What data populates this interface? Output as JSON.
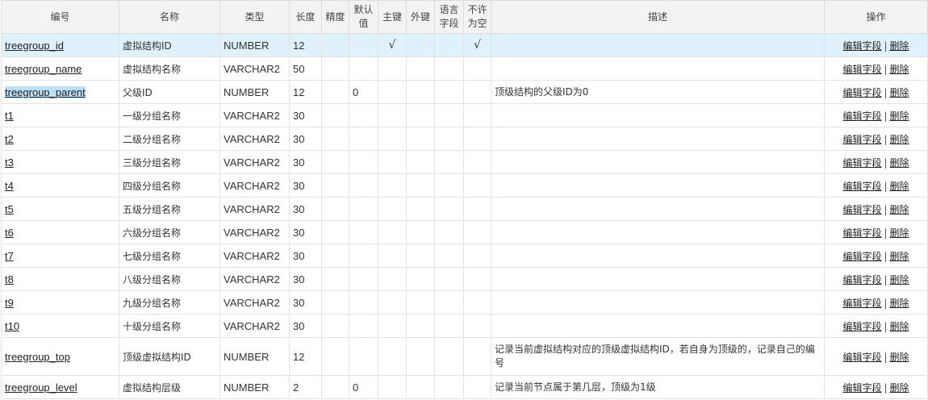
{
  "headers": {
    "code": "编号",
    "name": "名称",
    "type": "类型",
    "length": "长度",
    "precision": "精度",
    "default": "默认值",
    "primary_key": "主键",
    "foreign_key": "外键",
    "language_field": "语言字段",
    "not_null": "不许为空",
    "description": "描述",
    "operations": "操作"
  },
  "actions": {
    "edit": "编辑字段",
    "separator": "|",
    "delete": "删除"
  },
  "check_mark": "√",
  "rows": [
    {
      "code": "treegroup_id",
      "name": "虚拟结构ID",
      "type": "NUMBER",
      "length": "12",
      "precision": "",
      "default": "",
      "pk": "√",
      "fk": "",
      "lang": "",
      "notnull": "√",
      "desc": ""
    },
    {
      "code": "treegroup_name",
      "name": "虚拟结构名称",
      "type": "VARCHAR2",
      "length": "50",
      "precision": "",
      "default": "",
      "pk": "",
      "fk": "",
      "lang": "",
      "notnull": "",
      "desc": ""
    },
    {
      "code": "treegroup_parent",
      "name": "父级ID",
      "type": "NUMBER",
      "length": "12",
      "precision": "",
      "default": "0",
      "pk": "",
      "fk": "",
      "lang": "",
      "notnull": "",
      "desc": "顶级结构的父级ID为0"
    },
    {
      "code": "t1",
      "name": "一级分组名称",
      "type": "VARCHAR2",
      "length": "30",
      "precision": "",
      "default": "",
      "pk": "",
      "fk": "",
      "lang": "",
      "notnull": "",
      "desc": ""
    },
    {
      "code": "t2",
      "name": "二级分组名称",
      "type": "VARCHAR2",
      "length": "30",
      "precision": "",
      "default": "",
      "pk": "",
      "fk": "",
      "lang": "",
      "notnull": "",
      "desc": ""
    },
    {
      "code": "t3",
      "name": "三级分组名称",
      "type": "VARCHAR2",
      "length": "30",
      "precision": "",
      "default": "",
      "pk": "",
      "fk": "",
      "lang": "",
      "notnull": "",
      "desc": ""
    },
    {
      "code": "t4",
      "name": "四级分组名称",
      "type": "VARCHAR2",
      "length": "30",
      "precision": "",
      "default": "",
      "pk": "",
      "fk": "",
      "lang": "",
      "notnull": "",
      "desc": ""
    },
    {
      "code": "t5",
      "name": "五级分组名称",
      "type": "VARCHAR2",
      "length": "30",
      "precision": "",
      "default": "",
      "pk": "",
      "fk": "",
      "lang": "",
      "notnull": "",
      "desc": ""
    },
    {
      "code": "t6",
      "name": "六级分组名称",
      "type": "VARCHAR2",
      "length": "30",
      "precision": "",
      "default": "",
      "pk": "",
      "fk": "",
      "lang": "",
      "notnull": "",
      "desc": ""
    },
    {
      "code": "t7",
      "name": "七级分组名称",
      "type": "VARCHAR2",
      "length": "30",
      "precision": "",
      "default": "",
      "pk": "",
      "fk": "",
      "lang": "",
      "notnull": "",
      "desc": ""
    },
    {
      "code": "t8",
      "name": "八级分组名称",
      "type": "VARCHAR2",
      "length": "30",
      "precision": "",
      "default": "",
      "pk": "",
      "fk": "",
      "lang": "",
      "notnull": "",
      "desc": ""
    },
    {
      "code": "t9",
      "name": "九级分组名称",
      "type": "VARCHAR2",
      "length": "30",
      "precision": "",
      "default": "",
      "pk": "",
      "fk": "",
      "lang": "",
      "notnull": "",
      "desc": ""
    },
    {
      "code": "t10",
      "name": "十级分组名称",
      "type": "VARCHAR2",
      "length": "30",
      "precision": "",
      "default": "",
      "pk": "",
      "fk": "",
      "lang": "",
      "notnull": "",
      "desc": ""
    },
    {
      "code": "treegroup_top",
      "name": "顶级虚拟结构ID",
      "type": "NUMBER",
      "length": "12",
      "precision": "",
      "default": "",
      "pk": "",
      "fk": "",
      "lang": "",
      "notnull": "",
      "desc": "记录当前虚拟结构对应的顶级虚拟结构ID，若自身为顶级的，记录自己的编号"
    },
    {
      "code": "treegroup_level",
      "name": "虚拟结构层级",
      "type": "NUMBER",
      "length": "2",
      "precision": "",
      "default": "0",
      "pk": "",
      "fk": "",
      "lang": "",
      "notnull": "",
      "desc": "记录当前节点属于第几层，顶级为1级"
    }
  ]
}
